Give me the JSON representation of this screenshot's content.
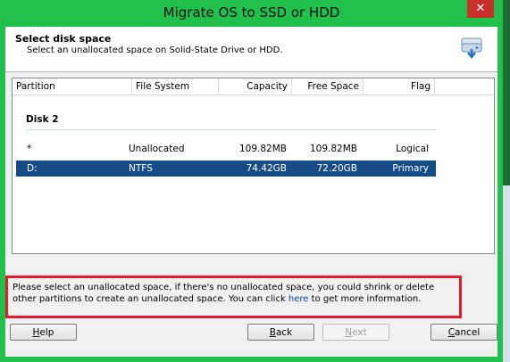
{
  "window": {
    "title": "Migrate OS to SSD or HDD",
    "close_glyph": "✕"
  },
  "header": {
    "title": "Select disk space",
    "subtitle": "Select an unallocated space on Solid-State Drive or HDD.",
    "icon": "disk-migrate-icon"
  },
  "table": {
    "columns": [
      "Partition",
      "File System",
      "Capacity",
      "Free Space",
      "Flag"
    ],
    "disk_label": "Disk 2",
    "rows": [
      {
        "partition": "*",
        "file_system": "Unallocated",
        "capacity": "109.82MB",
        "free_space": "109.82MB",
        "flag": "Logical",
        "selected": false
      },
      {
        "partition": "D:",
        "file_system": "NTFS",
        "capacity": "74.42GB",
        "free_space": "72.20GB",
        "flag": "Primary",
        "selected": true
      }
    ]
  },
  "info": {
    "text_before": "Please select an unallocated space, if there's no unallocated space, you could shrink or delete other partitions to create an unallocated space. You can click ",
    "link": "here",
    "text_after": " to get more information."
  },
  "buttons": {
    "help_first": "H",
    "help_rest": "elp",
    "back_first": "B",
    "back_rest": "ack",
    "next_first": "N",
    "next_rest": "ext",
    "cancel_first": "C",
    "cancel_rest": "ancel"
  },
  "colors": {
    "titlebar": "#21c04d",
    "selection": "#164c86",
    "highlight_border": "#e21b2d",
    "close": "#c7302b"
  }
}
